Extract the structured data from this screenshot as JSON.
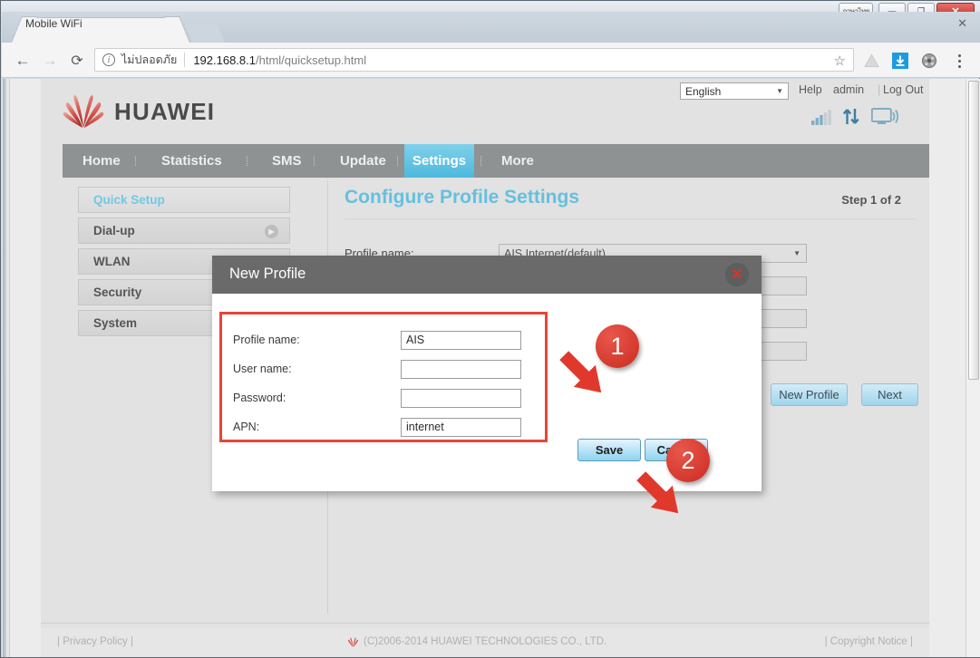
{
  "window": {
    "caption_buttons": {
      "thai_label": "ภาษาไทย",
      "minimize": "—",
      "maximize": "❐",
      "close": "✕"
    }
  },
  "browser": {
    "tab": {
      "title": "Mobile WiFi",
      "close_glyph": "✕"
    },
    "new_tab_label": "",
    "nav": {
      "back": "←",
      "forward": "→",
      "reload": "⟳"
    },
    "omnibox": {
      "info_icon": "i",
      "security_label": "ไม่ปลอดภัย",
      "url_host": "192.168.8.1",
      "url_path": "/html/quicksetup.html",
      "star_glyph": "☆"
    },
    "extensions": [
      "drive-icon",
      "download-icon",
      "extension-icon"
    ],
    "menu_glyph": "⋮"
  },
  "header": {
    "brand": "HUAWEI",
    "language": {
      "selected": "English",
      "arrow": "▼"
    },
    "links": {
      "help": "Help",
      "user": "admin",
      "separator": "|",
      "logout": "Log Out"
    },
    "status_icons": [
      "signal-bars-icon",
      "data-transfer-icon",
      "wifi-monitor-icon"
    ]
  },
  "nav": {
    "items": [
      {
        "label": "Home",
        "active": false
      },
      {
        "label": "Statistics",
        "active": false
      },
      {
        "label": "SMS",
        "active": false
      },
      {
        "label": "Update",
        "active": false
      },
      {
        "label": "Settings",
        "active": true
      },
      {
        "label": "More",
        "active": false
      }
    ]
  },
  "sidebar": {
    "items": [
      {
        "label": "Quick Setup",
        "active": true,
        "arrow": false
      },
      {
        "label": "Dial-up",
        "active": false,
        "arrow": true
      },
      {
        "label": "WLAN",
        "active": false,
        "arrow": true
      },
      {
        "label": "Security",
        "active": false,
        "arrow": true
      },
      {
        "label": "System",
        "active": false,
        "arrow": true
      }
    ],
    "arrow_glyph": "▶"
  },
  "main": {
    "title": "Configure Profile Settings",
    "step": "Step 1 of 2",
    "form": {
      "profile_name_label": "Profile name:",
      "profile_name_value": "AIS Internet(default)",
      "select_arrow": "▼"
    },
    "buttons": {
      "new_profile": "New Profile",
      "next": "Next"
    }
  },
  "dialog": {
    "title": "New Profile",
    "close_glyph": "✕",
    "fields": [
      {
        "label": "Profile name:",
        "value": "AIS"
      },
      {
        "label": "User name:",
        "value": ""
      },
      {
        "label": "Password:",
        "value": ""
      },
      {
        "label": "APN:",
        "value": "internet"
      }
    ],
    "save_label": "Save",
    "cancel_label": "Cancel"
  },
  "annotations": [
    {
      "number": "1"
    },
    {
      "number": "2"
    }
  ],
  "footer": {
    "privacy_prefix": "|",
    "privacy": "Privacy Policy",
    "privacy_suffix": "|",
    "copyright": "(C)2006-2014 HUAWEI TECHNOLOGIES CO., LTD.",
    "notice_prefix": "|",
    "notice": "Copyright Notice",
    "notice_suffix": "|"
  },
  "colors": {
    "accent_blue": "#65c0dd",
    "huawei_red": "#cc2b20",
    "nav_gray": "#8e9293",
    "annotation_red": "#e8443a"
  }
}
